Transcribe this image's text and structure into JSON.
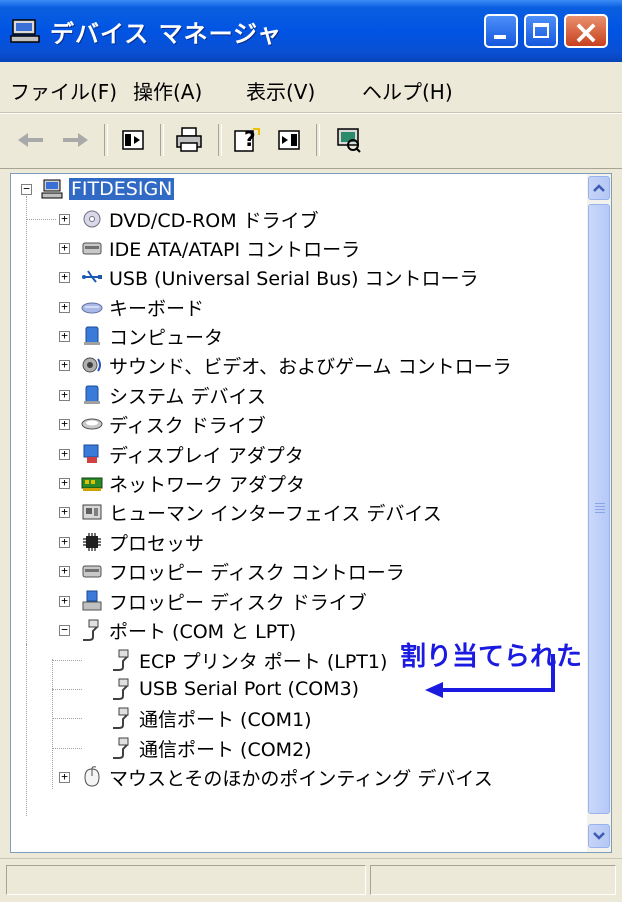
{
  "window": {
    "title": "デバイス マネージャ",
    "icon": "device-manager-icon",
    "buttons": [
      "minimize-icon",
      "maximize-icon",
      "close-icon"
    ]
  },
  "menu": [
    "ファイル(F)",
    "操作(A)",
    "表示(V)",
    "ヘルプ(H)"
  ],
  "toolbar": {
    "icons": [
      "back-arrow-icon",
      "forward-arrow-icon",
      "properties-pane-icon",
      "print-icon",
      "help-icon",
      "show-hide-pane-icon",
      "scan-hardware-icon"
    ]
  },
  "tree": {
    "root": "FITDESIGN",
    "categories": [
      "DVD/CD-ROM ドライブ",
      "IDE ATA/ATAPI コントローラ",
      "USB (Universal Serial Bus) コントローラ",
      "キーボード",
      "コンピュータ",
      "サウンド、ビデオ、およびゲーム コントローラ",
      "システム デバイス",
      "ディスク ドライブ",
      "ディスプレイ アダプタ",
      "ネットワーク アダプタ",
      "ヒューマン インターフェイス デバイス",
      "プロセッサ",
      "フロッピー ディスク コントローラ",
      "フロッピー ディスク ドライブ",
      "ポート (COM と LPT)"
    ],
    "ports": [
      "ECP プリンタ ポート (LPT1)",
      "USB Serial Port (COM3)",
      "通信ポート (COM1)",
      "通信ポート (COM2)"
    ],
    "last_category": "マウスとそのほかのポインティング デバイス"
  },
  "annotation": {
    "text": "割り当てられた",
    "color": "#1a1ae0"
  },
  "colors": {
    "title_bar": "#0054e3",
    "selection": "#316ac5"
  }
}
